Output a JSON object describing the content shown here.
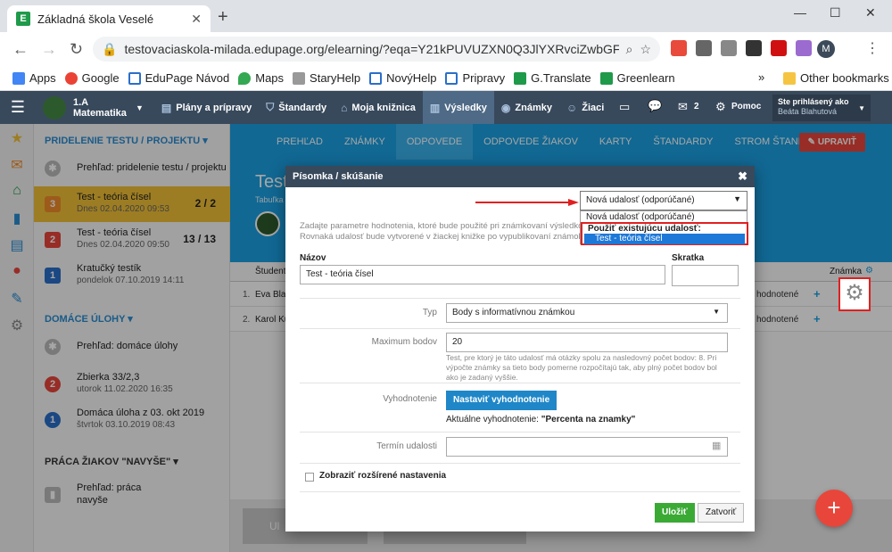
{
  "browser": {
    "tab_title": "Základná škola Veselé",
    "tab_favicon": "E",
    "url": "testovaciaskola-milada.edupage.org/elearning/?eqa=Y21kPUVUZXN0Q3JlYXRvciZwbGFua...",
    "profile_initial": "M",
    "bookmarks": [
      "Apps",
      "Google",
      "EduPage Návod",
      "Maps",
      "StaryHelp",
      "NovýHelp",
      "Pripravy",
      "G.Translate",
      "Greenlearn"
    ],
    "other_bookmarks": "Other bookmarks"
  },
  "app": {
    "class_name": "1.A",
    "subject": "Matematika",
    "nav": [
      "Plány a prípravy",
      "Štandardy",
      "Moja knižnica",
      "Výsledky",
      "Známky",
      "Žiaci"
    ],
    "messages_count": "2",
    "help_label": "Pomoc",
    "user_label": "Ste prihlásený ako",
    "user_name": "Beáta Blahutová"
  },
  "sidebar": {
    "section1": "PRIDELENIE TESTU / PROJEKTU",
    "overview1": "Prehľad: pridelenie testu / projektu",
    "items1": [
      {
        "num": "3",
        "title": "Test - teória čísel",
        "sub": "Dnes 02.04.2020 09:53",
        "count": "2 / 2",
        "color": "#f08c2a"
      },
      {
        "num": "2",
        "title": "Test - teória čísel",
        "sub": "Dnes 02.04.2020 09:50",
        "count": "13 / 13",
        "color": "#e8463b"
      },
      {
        "num": "1",
        "title": "Kratučký testík",
        "sub": "pondelok 07.10.2019 14:11",
        "count": "",
        "color": "#2a6fc9"
      }
    ],
    "section2": "DOMÁCE ÚLOHY",
    "overview2": "Prehľad: domáce úlohy",
    "items2": [
      {
        "num": "2",
        "title": "Zbierka 33/2,3",
        "sub": "utorok 11.02.2020 16:35",
        "color": "#e8463b"
      },
      {
        "num": "1",
        "title": "Domáca úloha z 03. okt 2019",
        "sub": "štvrtok 03.10.2019 08:43",
        "color": "#2a6fc9"
      }
    ],
    "section3": "PRÁCA ŽIAKOV \"NAVYŠE\"",
    "overview3_line1": "Prehľad: práca",
    "overview3_line2": "navyše"
  },
  "main": {
    "tabs": [
      "PREHĽAD",
      "ZNÁMKY",
      "ODPOVEDE",
      "ODPOVEDE ŽIAKOV",
      "KARTY",
      "ŠTANDARDY",
      "STROM ŠTANDARDOV"
    ],
    "active_tab": 2,
    "edit_button": "UPRAVIŤ",
    "title": "Test",
    "subtitle": "Tabuľka",
    "col_student": "Študent",
    "col_grade": "Známka",
    "rows": [
      {
        "num": "1.",
        "name": "Eva Blah",
        "status": "hodnotené"
      },
      {
        "num": "2.",
        "name": "Karol Ku",
        "status": "hodnotené"
      }
    ],
    "bottom_btn1": "Ul",
    "fab": "+"
  },
  "modal": {
    "title": "Písomka / skúšanie",
    "intro_line1": "Zadajte parametre hodnotenia, ktoré bude použité pri známkovaní výsledkov z",
    "intro_line2": "Rovnaká udalosť bude vytvorené v žiackej knižke po vypublikovaní známok",
    "event_select": "Nová udalosť (odporúčané)",
    "event_options": {
      "new": "Nová udalosť (odporúčané)",
      "group_label": "Použiť existujúcu udalosť:",
      "existing": "Test - teória čísel"
    },
    "name_label": "Názov",
    "name_value": "Test - teória čísel",
    "short_label": "Skratka",
    "short_value": "",
    "type_label": "Typ",
    "type_value": "Body s informatívnou známkou",
    "max_label": "Maximum bodov",
    "max_value": "20",
    "max_help": "Test, pre ktorý je táto udalosť má otázky spolu za nasledovný počet bodov: 8. Pri výpočte známky sa tieto body pomerne rozpočítajú tak, aby plný počet bodov bol ako je zadaný vyššie.",
    "eval_label": "Vyhodnotenie",
    "eval_button": "Nastaviť vyhodnotenie",
    "eval_current_prefix": "Aktuálne vyhodnotenie:",
    "eval_current_value": "\"Percenta na znamky\"",
    "date_label": "Termín udalosti",
    "date_value": "",
    "advanced_label": "Zobraziť rozšírené nastavenia",
    "save_button": "Uložiť",
    "close_button": "Zatvoriť"
  }
}
